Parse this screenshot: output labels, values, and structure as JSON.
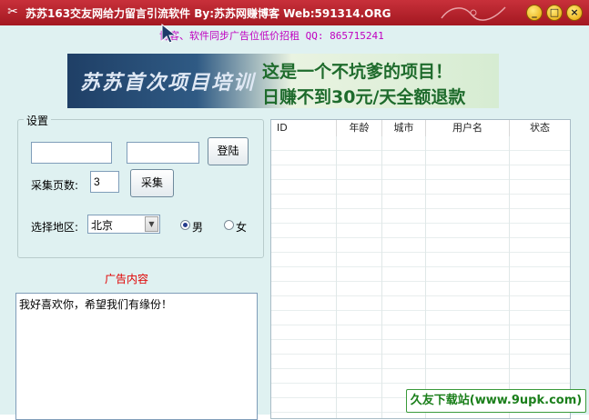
{
  "window": {
    "title": "苏苏163交友网给力留言引流软件 By:苏苏网赚博客  Web:591314.ORG",
    "minimize": "_",
    "maximize": "□",
    "close": "×",
    "app_icon": "ribbon-icon"
  },
  "marquee": {
    "text": "博客、软件同步广告位低价招租  QQ: 865715241"
  },
  "banner": {
    "left_text": "苏苏首次项目培训",
    "right_line1": "这是一个不坑爹的项目！",
    "right_line2": "日赚不到30元/天全额退款"
  },
  "settings": {
    "legend": "设置",
    "username_value": "",
    "password_value": "",
    "login_label": "登陆",
    "pages_label": "采集页数:",
    "pages_value": "3",
    "collect_label": "采集",
    "region_label": "选择地区:",
    "region_value": "北京",
    "gender_male": "男",
    "gender_female": "女",
    "gender_selected": "male"
  },
  "ad": {
    "title": "广告内容",
    "content": "我好喜欢你，希望我们有缘份！"
  },
  "table": {
    "columns": [
      "ID",
      "年龄",
      "城市",
      "用户名",
      "状态"
    ],
    "rows": []
  },
  "watermark": {
    "text": "久友下载站(www.9upk.com)"
  },
  "colors": {
    "titlebar": "#b3232c",
    "client_bg": "#dff1f1",
    "marquee": "#c000c0",
    "ad_title": "#e00000",
    "banner_text": "#1e6b2c"
  }
}
